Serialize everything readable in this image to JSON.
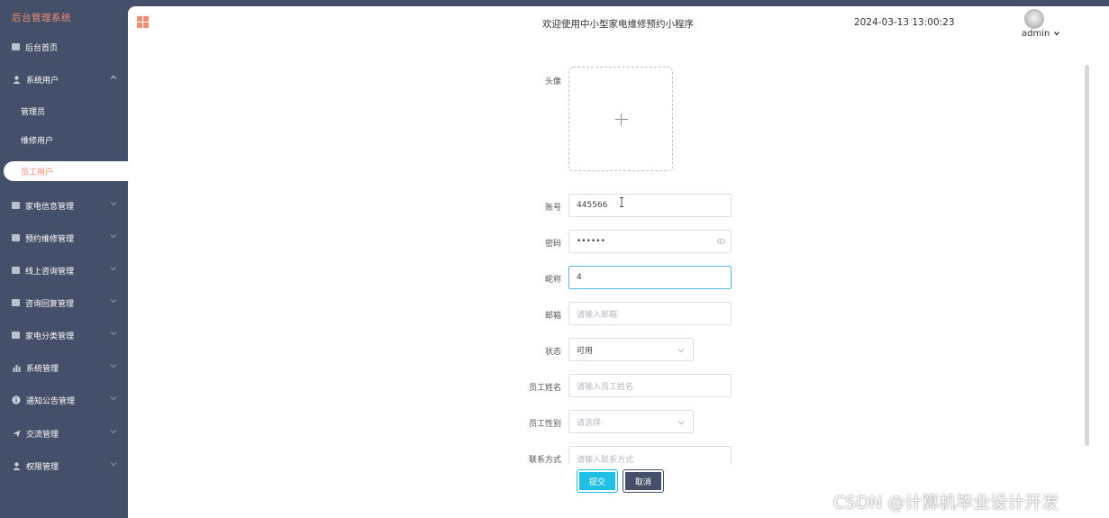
{
  "sidebar": {
    "brand": "后台管理系统",
    "items": [
      {
        "label": "后台首页",
        "icon": "monitor-icon"
      },
      {
        "label": "系统用户",
        "icon": "user-icon",
        "expanded": true
      },
      {
        "label": "管理员"
      },
      {
        "label": "维修用户"
      },
      {
        "label": "员工用户",
        "active": true
      },
      {
        "label": "家电信息管理",
        "icon": "list-icon"
      },
      {
        "label": "预约维修管理",
        "icon": "list-icon"
      },
      {
        "label": "线上咨询管理",
        "icon": "list-icon"
      },
      {
        "label": "咨询回复管理",
        "icon": "list-icon"
      },
      {
        "label": "家电分类管理",
        "icon": "list-icon"
      },
      {
        "label": "系统管理",
        "icon": "bar-chart-icon"
      },
      {
        "label": "通知公告管理",
        "icon": "info-icon"
      },
      {
        "label": "交流管理",
        "icon": "send-icon"
      },
      {
        "label": "权限管理",
        "icon": "user-icon"
      }
    ]
  },
  "header": {
    "welcome": "欢迎使用中小型家电维修预约小程序",
    "datetime": "2024-03-13 13:00:23",
    "username": "admin"
  },
  "form": {
    "avatar_label": "头像",
    "account_label": "账号",
    "account_value": "445566",
    "password_label": "密码",
    "password_value": "••••••",
    "nickname_label": "昵称",
    "nickname_value": "4",
    "email_label": "邮箱",
    "email_placeholder": "请输入邮箱",
    "status_label": "状态",
    "status_value": "可用",
    "name_label": "员工姓名",
    "name_placeholder": "请输入员工姓名",
    "gender_label": "员工性别",
    "gender_placeholder": "请选择",
    "contact_label": "联系方式",
    "contact_placeholder": "请输入联系方式",
    "submit_label": "提交",
    "cancel_label": "取消"
  },
  "watermark": "CSDN @计算机毕业设计开发",
  "colors": {
    "sidebar_bg": "#44506a",
    "accent": "#f08b6f",
    "submit": "#1fc0e3"
  }
}
